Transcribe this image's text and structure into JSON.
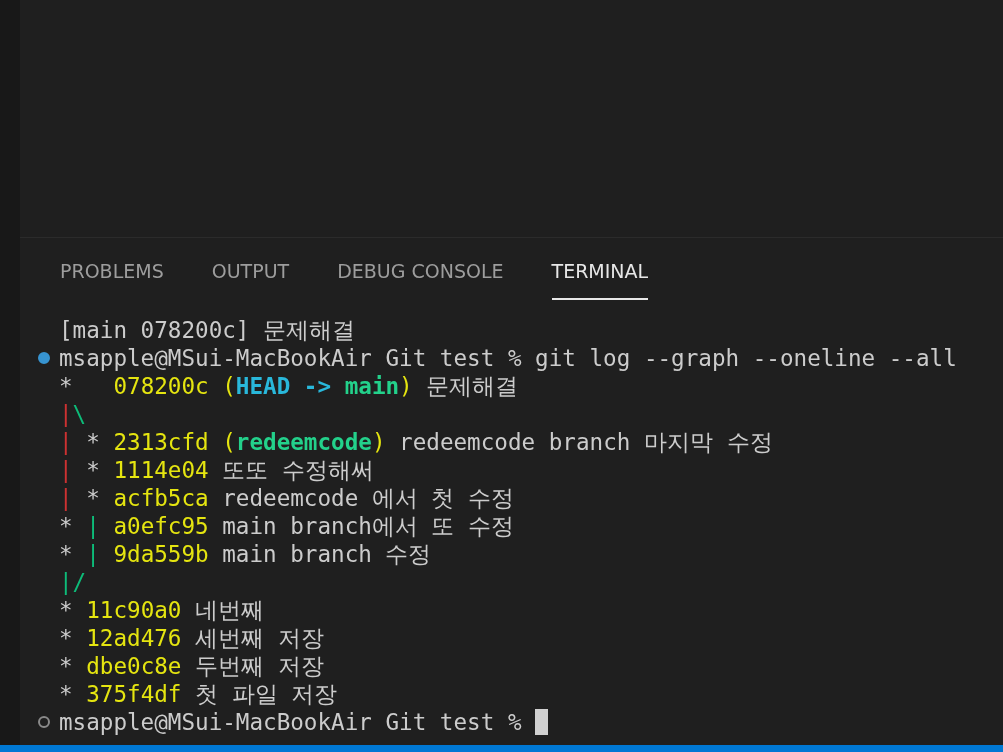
{
  "tabs": [
    {
      "label": "PROBLEMS",
      "selected": false
    },
    {
      "label": "OUTPUT",
      "selected": false
    },
    {
      "label": "DEBUG CONSOLE",
      "selected": false
    },
    {
      "label": "TERMINAL",
      "selected": true
    }
  ],
  "terminal": {
    "lines": [
      {
        "kind": "output",
        "segments": [
          {
            "kind": "text",
            "text": "[main 078200c] 문제해결"
          }
        ]
      },
      {
        "kind": "command",
        "finished": true,
        "segments": [
          {
            "kind": "text",
            "text": "msapple@MSui-MacBookAir Git test % git log --graph --oneline --all"
          }
        ]
      },
      {
        "kind": "output",
        "segments": [
          {
            "kind": "text",
            "text": "*   "
          },
          {
            "kind": "hash",
            "text": "078200c ("
          },
          {
            "kind": "head",
            "text": "HEAD -> "
          },
          {
            "kind": "ref",
            "text": "main"
          },
          {
            "kind": "hash",
            "text": ")"
          },
          {
            "kind": "text",
            "text": " 문제해결"
          }
        ]
      },
      {
        "kind": "output",
        "segments": [
          {
            "kind": "edge_red",
            "text": "|"
          },
          {
            "kind": "edge_green",
            "text": "\\"
          }
        ]
      },
      {
        "kind": "output",
        "segments": [
          {
            "kind": "edge_red",
            "text": "|"
          },
          {
            "kind": "text",
            "text": " * "
          },
          {
            "kind": "hash",
            "text": "2313cfd ("
          },
          {
            "kind": "ref",
            "text": "redeemcode"
          },
          {
            "kind": "hash",
            "text": ")"
          },
          {
            "kind": "text",
            "text": " redeemcode branch 마지막 수정"
          }
        ]
      },
      {
        "kind": "output",
        "segments": [
          {
            "kind": "edge_red",
            "text": "|"
          },
          {
            "kind": "text",
            "text": " * "
          },
          {
            "kind": "hash",
            "text": "1114e04"
          },
          {
            "kind": "text",
            "text": " 또또 수정해써"
          }
        ]
      },
      {
        "kind": "output",
        "segments": [
          {
            "kind": "edge_red",
            "text": "|"
          },
          {
            "kind": "text",
            "text": " * "
          },
          {
            "kind": "hash",
            "text": "acfb5ca"
          },
          {
            "kind": "text",
            "text": " redeemcode 에서 첫 수정"
          }
        ]
      },
      {
        "kind": "output",
        "segments": [
          {
            "kind": "text",
            "text": "* "
          },
          {
            "kind": "edge_green",
            "text": "|"
          },
          {
            "kind": "hash",
            "text": " a0efc95"
          },
          {
            "kind": "text",
            "text": " main branch에서 또 수정"
          }
        ]
      },
      {
        "kind": "output",
        "segments": [
          {
            "kind": "text",
            "text": "* "
          },
          {
            "kind": "edge_green",
            "text": "|"
          },
          {
            "kind": "hash",
            "text": " 9da559b"
          },
          {
            "kind": "text",
            "text": " main branch 수정"
          }
        ]
      },
      {
        "kind": "output",
        "segments": [
          {
            "kind": "edge_green",
            "text": "|/"
          }
        ]
      },
      {
        "kind": "output",
        "segments": [
          {
            "kind": "text",
            "text": "* "
          },
          {
            "kind": "hash",
            "text": "11c90a0"
          },
          {
            "kind": "text",
            "text": " 네번째"
          }
        ]
      },
      {
        "kind": "output",
        "segments": [
          {
            "kind": "text",
            "text": "* "
          },
          {
            "kind": "hash",
            "text": "12ad476"
          },
          {
            "kind": "text",
            "text": " 세번째 저장"
          }
        ]
      },
      {
        "kind": "output",
        "segments": [
          {
            "kind": "text",
            "text": "* "
          },
          {
            "kind": "hash",
            "text": "dbe0c8e"
          },
          {
            "kind": "text",
            "text": " 두번째 저장"
          }
        ]
      },
      {
        "kind": "output",
        "segments": [
          {
            "kind": "text",
            "text": "* "
          },
          {
            "kind": "hash",
            "text": "375f4df"
          },
          {
            "kind": "text",
            "text": " 첫 파일 저장"
          }
        ]
      },
      {
        "kind": "command",
        "finished": false,
        "cursor": true,
        "segments": [
          {
            "kind": "text",
            "text": "msapple@MSui-MacBookAir Git test % "
          }
        ]
      }
    ]
  }
}
